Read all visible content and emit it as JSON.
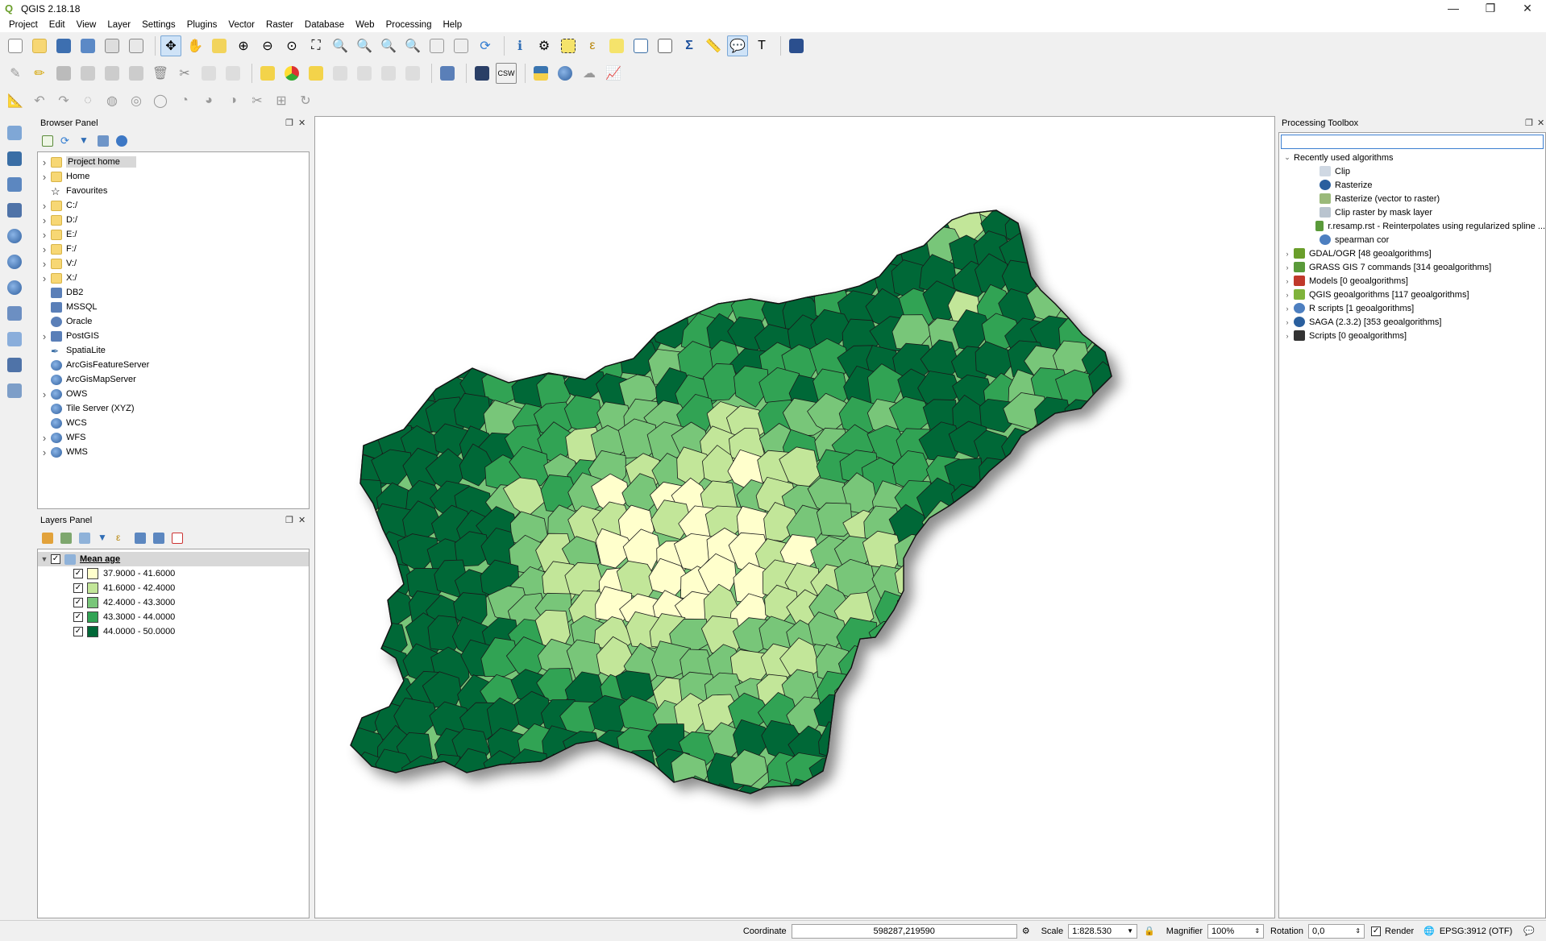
{
  "window": {
    "title": "QGIS 2.18.18",
    "controls": {
      "minimize": "—",
      "restore": "❐",
      "close": "✕"
    }
  },
  "menubar": [
    "Project",
    "Edit",
    "View",
    "Layer",
    "Settings",
    "Plugins",
    "Vector",
    "Raster",
    "Database",
    "Web",
    "Processing",
    "Help"
  ],
  "browser_panel": {
    "title": "Browser Panel",
    "items": [
      {
        "label": "Project home",
        "icon": "folder-icon",
        "expandable": true,
        "selected": true
      },
      {
        "label": "Home",
        "icon": "folder-icon",
        "expandable": true
      },
      {
        "label": "Favourites",
        "icon": "star-icon",
        "expandable": false
      },
      {
        "label": "C:/",
        "icon": "folder-icon",
        "expandable": true
      },
      {
        "label": "D:/",
        "icon": "folder-icon",
        "expandable": true
      },
      {
        "label": "E:/",
        "icon": "folder-icon",
        "expandable": true
      },
      {
        "label": "F:/",
        "icon": "folder-icon",
        "expandable": true
      },
      {
        "label": "V:/",
        "icon": "folder-icon",
        "expandable": true
      },
      {
        "label": "X:/",
        "icon": "folder-icon",
        "expandable": true
      },
      {
        "label": "DB2",
        "icon": "db2-icon",
        "expandable": false
      },
      {
        "label": "MSSQL",
        "icon": "mssql-icon",
        "expandable": false
      },
      {
        "label": "Oracle",
        "icon": "oracle-icon",
        "expandable": false
      },
      {
        "label": "PostGIS",
        "icon": "postgis-icon",
        "expandable": true
      },
      {
        "label": "SpatiaLite",
        "icon": "spatialite-icon",
        "expandable": false
      },
      {
        "label": "ArcGisFeatureServer",
        "icon": "globe-icon",
        "expandable": false
      },
      {
        "label": "ArcGisMapServer",
        "icon": "globe-icon",
        "expandable": false
      },
      {
        "label": "OWS",
        "icon": "globe-icon",
        "expandable": true
      },
      {
        "label": "Tile Server (XYZ)",
        "icon": "globe-icon",
        "expandable": false
      },
      {
        "label": "WCS",
        "icon": "globe-icon",
        "expandable": false
      },
      {
        "label": "WFS",
        "icon": "globe-icon",
        "expandable": true
      },
      {
        "label": "WMS",
        "icon": "globe-icon",
        "expandable": true
      }
    ]
  },
  "layers_panel": {
    "title": "Layers Panel",
    "layer": {
      "name": "Mean age",
      "checked": true
    },
    "classes": [
      {
        "label": "37.9000 - 41.6000",
        "color": "#ffffcc",
        "checked": true
      },
      {
        "label": "41.6000 - 42.4000",
        "color": "#c2e699",
        "checked": true
      },
      {
        "label": "42.4000 - 43.3000",
        "color": "#78c679",
        "checked": true
      },
      {
        "label": "43.3000 - 44.0000",
        "color": "#31a354",
        "checked": true
      },
      {
        "label": "44.0000 - 50.0000",
        "color": "#006837",
        "checked": true
      }
    ]
  },
  "processing_toolbox": {
    "title": "Processing Toolbox",
    "search_placeholder": "",
    "recent": {
      "label": "Recently used algorithms",
      "items": [
        {
          "label": "Clip",
          "icon": "clip-icon"
        },
        {
          "label": "Rasterize",
          "icon": "saga-icon"
        },
        {
          "label": "Rasterize (vector to raster)",
          "icon": "rasterize-icon"
        },
        {
          "label": "Clip raster by mask layer",
          "icon": "clip-raster-icon"
        },
        {
          "label": "r.resamp.rst - Reinterpolates using regularized spline ...",
          "icon": "grass-icon"
        },
        {
          "label": "spearman cor",
          "icon": "r-icon"
        }
      ]
    },
    "providers": [
      {
        "label": "GDAL/OGR [48 geoalgorithms]",
        "icon": "gdal-icon"
      },
      {
        "label": "GRASS GIS 7 commands [314 geoalgorithms]",
        "icon": "grass-icon"
      },
      {
        "label": "Models [0 geoalgorithms]",
        "icon": "models-icon"
      },
      {
        "label": "QGIS geoalgorithms [117 geoalgorithms]",
        "icon": "qgis-icon"
      },
      {
        "label": "R scripts [1 geoalgorithms]",
        "icon": "r-icon"
      },
      {
        "label": "SAGA (2.3.2) [353 geoalgorithms]",
        "icon": "saga-icon"
      },
      {
        "label": "Scripts [0 geoalgorithms]",
        "icon": "scripts-icon"
      }
    ]
  },
  "statusbar": {
    "coordinate_label": "Coordinate",
    "coordinate_value": "598287,219590",
    "scale_label": "Scale",
    "scale_value": "1:828.530",
    "magnifier_label": "Magnifier",
    "magnifier_value": "100%",
    "rotation_label": "Rotation",
    "rotation_value": "0,0",
    "render_label": "Render",
    "render_checked": true,
    "crs_label": "EPSG:3912 (OTF)"
  },
  "map": {
    "colors": [
      "#ffffcc",
      "#c2e699",
      "#78c679",
      "#31a354",
      "#006837"
    ]
  }
}
